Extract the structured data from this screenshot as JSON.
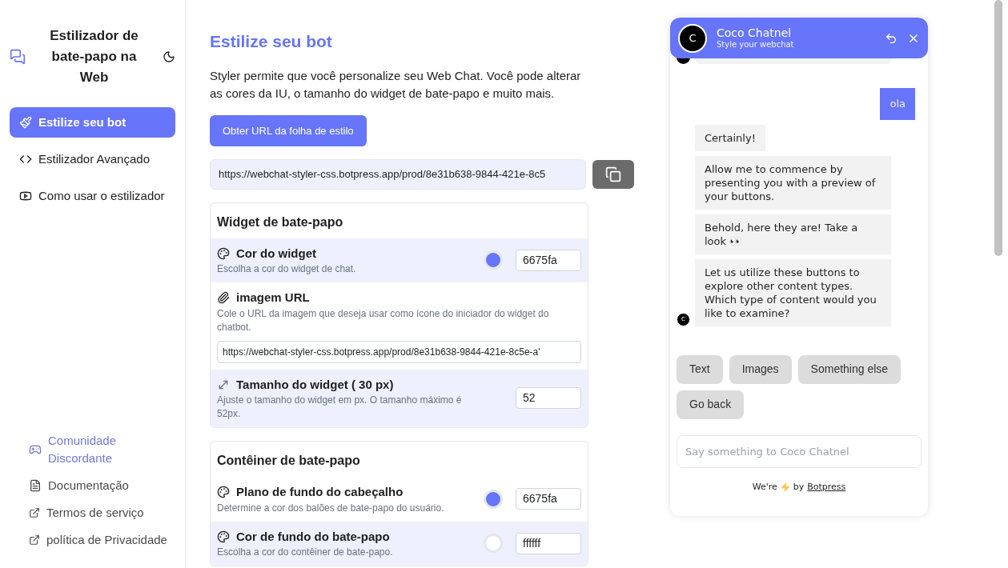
{
  "sidebar": {
    "title": "Estilizador de bate-papo na Web",
    "nav": [
      {
        "label": "Estilize seu bot",
        "selected": true
      },
      {
        "label": "Estilizador Avançado",
        "selected": false
      },
      {
        "label": "Como usar o estilizador",
        "selected": false
      }
    ],
    "links": [
      {
        "label": "Comunidade Discordante",
        "color": "#7479d6"
      },
      {
        "label": "Documentação",
        "color": "#4b4b4b"
      },
      {
        "label": "Termos de serviço",
        "color": "#4b4b4b"
      },
      {
        "label": "política de Privacidade",
        "color": "#4b4b4b"
      }
    ]
  },
  "main": {
    "title": "Estilize seu bot",
    "description": "Styler permite que você personalize seu Web Chat. Você pode alterar as cores da IU, o tamanho do widget de bate-papo e muito mais.",
    "stylesheet_button": "Obter URL da folha de estilo",
    "stylesheet_url": "https://webchat-styler-css.botpress.app/prod/8e31b638-9844-421e-8c5",
    "sections": [
      {
        "title": "Widget de bate-papo",
        "rows": [
          {
            "kind": "color",
            "label": "Cor do widget",
            "hint": "Escolha a cor do widget de chat.",
            "color": "#6675fa",
            "value": "6675fa",
            "shaded": true
          },
          {
            "kind": "url",
            "label": "imagem URL",
            "hint": "Cole o URL da imagem que deseja usar como ícone do iniciador do widget do chatbot.",
            "value": "https://webchat-styler-css.botpress.app/prod/8e31b638-9844-421e-8c5e-a'",
            "shaded": false
          },
          {
            "kind": "number",
            "label": "Tamanho do widget (  30  px)",
            "hint": "Ajuste o tamanho do widget em px. O tamanho máximo é 52px.",
            "value": "52",
            "shaded": true
          }
        ]
      },
      {
        "title": "Contêiner de bate-papo",
        "rows": [
          {
            "kind": "color",
            "label": "Plano de fundo do cabeçalho",
            "hint": "Determine a cor dos balões de bate-papo do usuário.",
            "color": "#6675fa",
            "value": "6675fa",
            "shaded": false
          },
          {
            "kind": "color",
            "label": "Cor de fundo do bate-papo",
            "hint": "Escolha a cor do contêiner de bate-papo.",
            "color": "#ffffff",
            "value": "ffffff",
            "shaded": true
          }
        ]
      }
    ]
  },
  "chat": {
    "avatar": "C",
    "name": "Coco Chatnel",
    "subtitle": "Style your webchat",
    "messages": [
      {
        "kind": "cut"
      },
      {
        "kind": "user",
        "text": "ola"
      },
      {
        "kind": "bot",
        "text": "Certainly!"
      },
      {
        "kind": "bot",
        "text": "Allow me to commence by presenting you with a preview of your buttons."
      },
      {
        "kind": "bot",
        "text": "Behold, here they are! Take a look 👀"
      },
      {
        "kind": "bot",
        "text": "Let us utilize these buttons to explore other content types. Which type of content would you like to examine?",
        "avatar": "C"
      }
    ],
    "choices": [
      "Text",
      "Images",
      "Something else",
      "Go back"
    ],
    "placeholder": "Say something to Coco Chatnel",
    "footer_before": "We're",
    "footer_after": "by",
    "footer_link": "Botpress"
  }
}
